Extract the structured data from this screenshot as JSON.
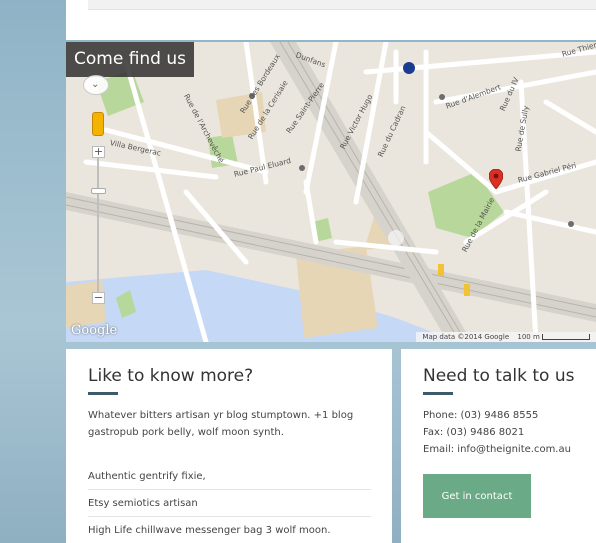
{
  "colors": {
    "accent_rule": "#3f5a6b",
    "button_bg": "#6aaa86",
    "park": "#b7d89a",
    "water": "#c5d8f5",
    "building": "#e6d6b5"
  },
  "map": {
    "title": "Come find us",
    "google_logo": "Google",
    "attribution": "Map data ©2014 Google",
    "scale_label": "100 m",
    "zoom_in": "+",
    "zoom_out": "−",
    "road_labels": [
      "Rue des Bordeaux",
      "Rue de la Cerisaie",
      "Rue Saint-Pierre",
      "Rue Victor Hugo",
      "Rue du Cadran",
      "Rue d'Alembert",
      "Villa Bergerac",
      "Rue Paul Eluard",
      "Rue de la Mairie",
      "Rue Gabriel Péri",
      "Rue de Sully",
      "Rue de l'Archevêché",
      "Dunfans",
      "Rue Thiers",
      "Rue du IV"
    ],
    "icons": [
      "pegman-icon",
      "map-pin-icon",
      "metro-icon"
    ]
  },
  "left_panel": {
    "heading": "Like to know more?",
    "intro": "Whatever bitters artisan yr blog stumptown. +1 blog gastropub pork belly, wolf moon synth.",
    "items": [
      "Authentic gentrify fixie,",
      "Etsy semiotics artisan",
      "High Life chillwave messenger bag 3 wolf moon."
    ]
  },
  "right_panel": {
    "heading": "Need to talk to us",
    "phone": "Phone: (03) 9486 8555",
    "fax": "Fax: (03) 9486 8021",
    "email": "Email: info@theignite.com.au",
    "button_label": "Get in contact"
  }
}
